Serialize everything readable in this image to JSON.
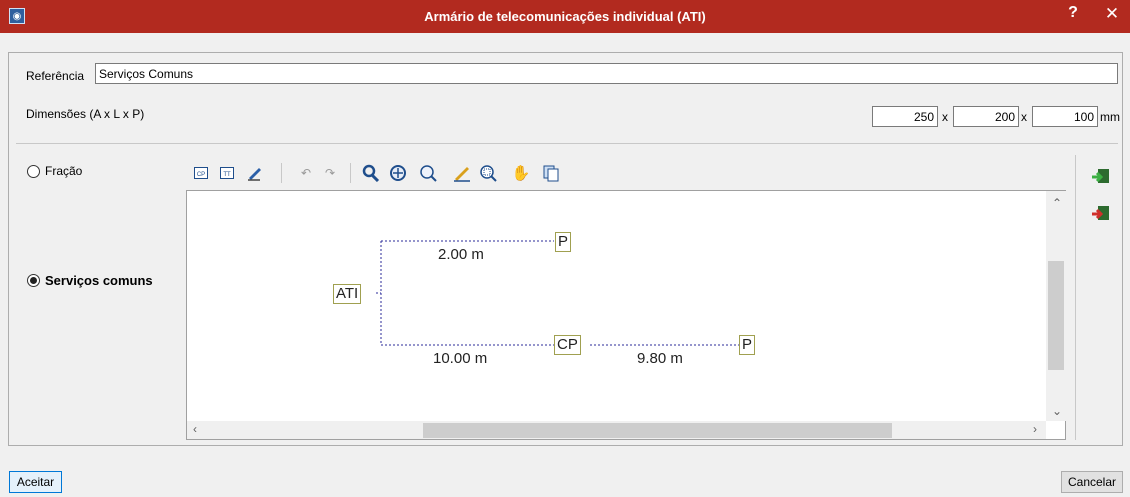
{
  "window": {
    "title": "Armário de telecomunicações individual (ATI)",
    "help": "?",
    "close": "✕"
  },
  "reference": {
    "label": "Referência",
    "value": "Serviços Comuns"
  },
  "dimensions": {
    "label": "Dimensões (A x L x P)",
    "a": "250",
    "l": "200",
    "p": "100",
    "sep1": "x",
    "sep2": "x",
    "unit": "mm"
  },
  "options": {
    "fracao": "Fração",
    "servicos": "Serviços comuns",
    "selected": "servicos"
  },
  "toolbar": {
    "icons": [
      "cp-icon",
      "tt-icon",
      "edit-icon",
      "undo-icon",
      "redo-icon",
      "pick-icon",
      "zoom-all-icon",
      "zoom-icon",
      "draw-icon",
      "zoom-window-icon",
      "pan-icon",
      "copy-icon"
    ],
    "cp_label": "CP",
    "tt_label": "TT"
  },
  "diagram": {
    "nodes": {
      "ati": "ATI",
      "p1": "P",
      "cp": "CP",
      "p2": "P"
    },
    "distances": {
      "d1": "2.00 m",
      "d2": "10.00 m",
      "d3": "9.80 m"
    },
    "line_color": "#2b2b9a",
    "node_border": "#a0a050"
  },
  "side": {
    "import": "import-icon",
    "export": "export-icon"
  },
  "buttons": {
    "accept": "Aceitar",
    "cancel": "Cancelar"
  },
  "colors": {
    "titlebar": "#b22a1f",
    "accent": "#0078d7"
  }
}
